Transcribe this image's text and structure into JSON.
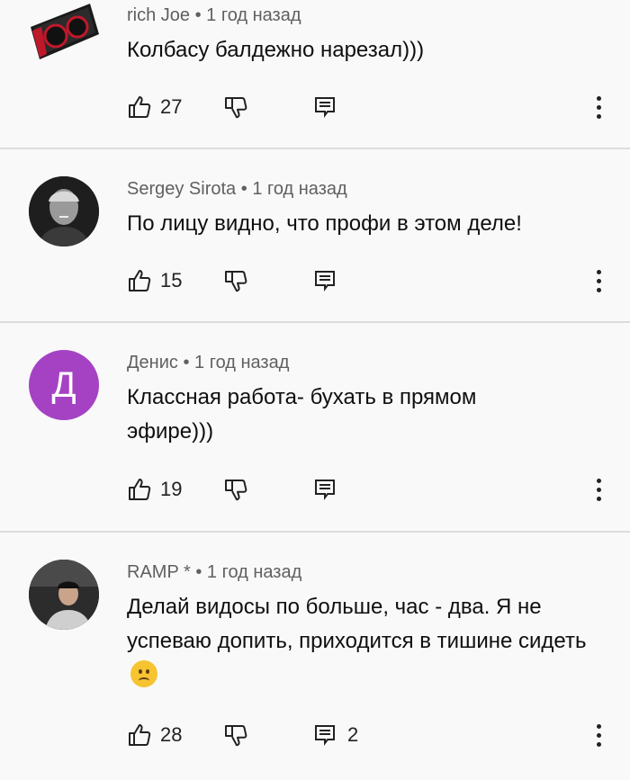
{
  "comments": [
    {
      "author": "rich Joe",
      "separator": "•",
      "time": "1 год назад",
      "text": "Колбасу балдежно нарезал)))",
      "likes": "27",
      "replies": ""
    },
    {
      "author": "Sergey Sirota",
      "separator": "•",
      "time": "1 год назад",
      "text": "По лицу видно, что профи в этом деле!",
      "likes": "15",
      "replies": ""
    },
    {
      "author": "Денис",
      "avatar_letter": "Д",
      "avatar_color": "#a542c4",
      "separator": "•",
      "time": "1 год назад",
      "text": "Классная работа- бухать в прямом эфире)))",
      "likes": "19",
      "replies": ""
    },
    {
      "author": "RAMP *",
      "separator": "•",
      "time": "1 год назад",
      "text": "Делай видосы по больше, час - два. Я не успеваю допить, приходится в тишине сидеть",
      "emoji": "confused-face",
      "likes": "28",
      "replies": "2"
    }
  ]
}
